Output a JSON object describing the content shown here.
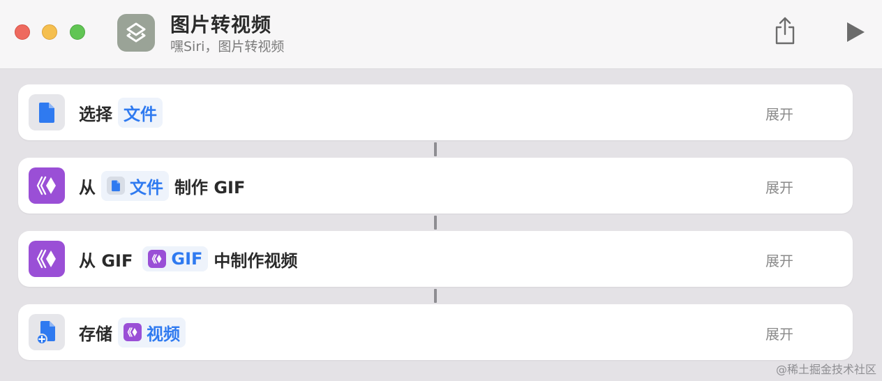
{
  "window": {
    "title": "图片转视频",
    "subtitle": "嘿Siri，图片转视频"
  },
  "toolbar": {
    "share_icon": "share-icon",
    "run_icon": "play-icon"
  },
  "actions": [
    {
      "icon": "document-icon",
      "pre": "选择",
      "token": "文件",
      "post": "",
      "expand": "展开"
    },
    {
      "icon": "gif-maker-icon",
      "pre": "从",
      "token_icon": "document-icon",
      "token": "文件",
      "post": "制作 GIF",
      "expand": "展开"
    },
    {
      "icon": "gif-maker-icon",
      "pre": "从 GIF",
      "token_icon": "gif-maker-icon",
      "token": "GIF",
      "post": "中制作视频",
      "expand": "展开"
    },
    {
      "icon": "save-file-icon",
      "pre": "存储",
      "token_icon": "gif-maker-icon",
      "token": "视频",
      "post": "",
      "expand": "展开"
    }
  ],
  "watermark": "@稀土掘金技术社区",
  "colors": {
    "accent": "#2f7af0",
    "gif_purple": "#9a4fd6",
    "file_blue": "#2f7af0",
    "background": "#e4e2e6"
  }
}
